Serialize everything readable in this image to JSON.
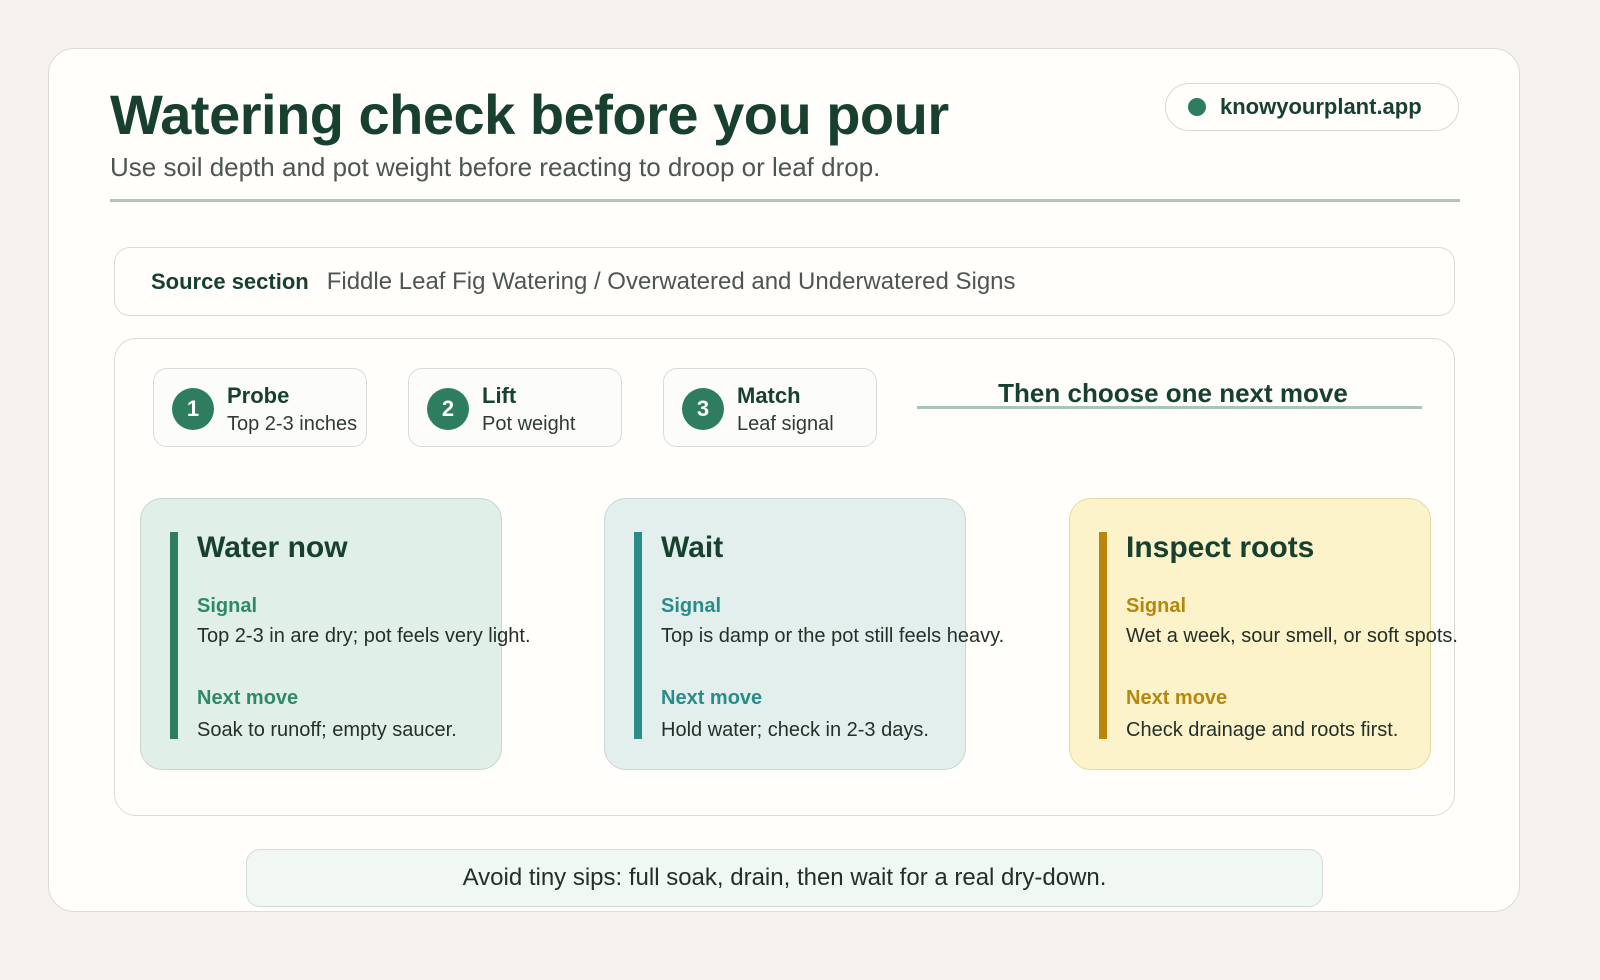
{
  "header": {
    "title": "Watering check before you pour",
    "subtitle": "Use soil depth and pot weight before reacting to droop or leaf drop.",
    "site": "knowyourplant.app"
  },
  "source": {
    "label": "Source section",
    "value": "Fiddle Leaf Fig Watering / Overwatered and Underwatered Signs"
  },
  "steps": [
    {
      "number": "1",
      "title": "Probe",
      "desc": "Top 2-3 inches"
    },
    {
      "number": "2",
      "title": "Lift",
      "desc": "Pot weight"
    },
    {
      "number": "3",
      "title": "Match",
      "desc": "Leaf signal"
    }
  ],
  "next_heading": "Then choose one next move",
  "options": [
    {
      "title": "Water now",
      "signal_label": "Signal",
      "signal": "Top 2-3 in are dry; pot feels very light.",
      "next_label": "Next move",
      "next": "Soak to runoff; empty saucer.",
      "accent": "#2e7d5f"
    },
    {
      "title": "Wait",
      "signal_label": "Signal",
      "signal": "Top is damp or the pot still feels heavy.",
      "next_label": "Next move",
      "next": "Hold water; check in 2-3 days.",
      "accent": "#2a8c86"
    },
    {
      "title": "Inspect roots",
      "signal_label": "Signal",
      "signal": "Wet a week, sour smell, or soft spots.",
      "next_label": "Next move",
      "next": "Check drainage and roots first.",
      "accent": "#b8860b"
    }
  ],
  "tip": "Avoid tiny sips: full soak, drain, then wait for a real dry-down."
}
